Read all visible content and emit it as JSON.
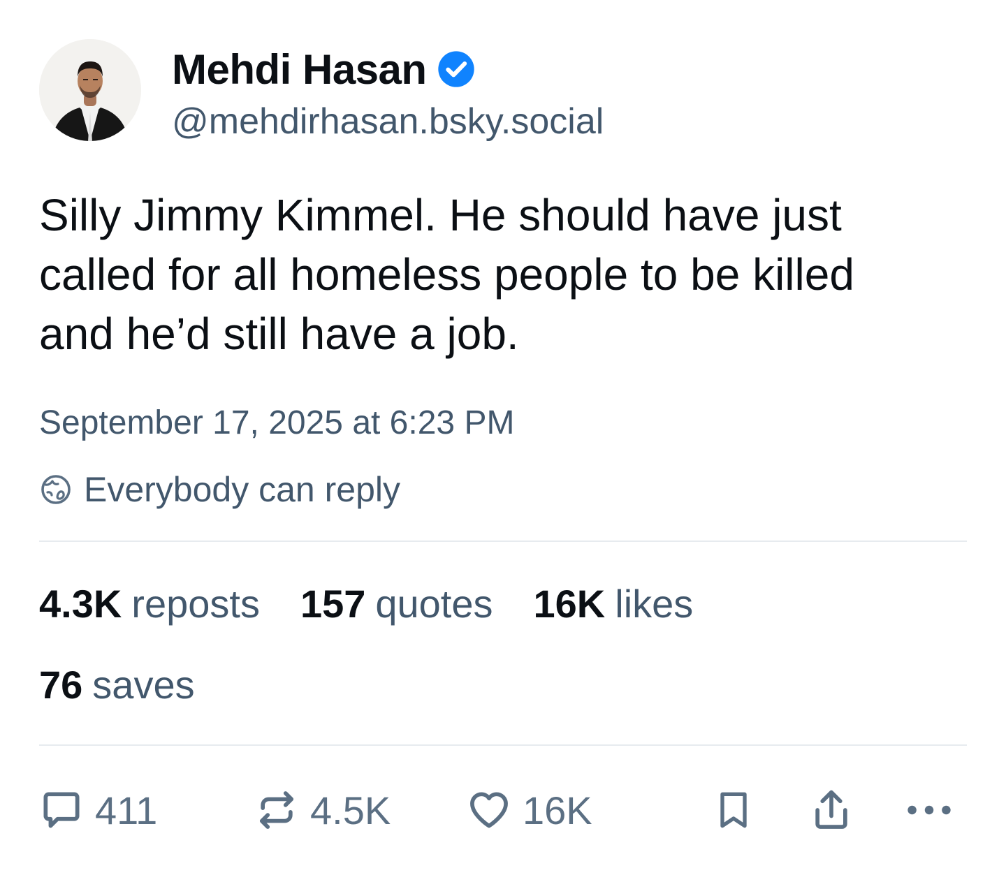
{
  "author": {
    "display_name": "Mehdi Hasan",
    "handle": "@mehdirhasan.bsky.social",
    "verified": true,
    "avatar_icon": "profile-photo"
  },
  "post": {
    "text": "Silly Jimmy Kimmel. He should have just called for all homeless people to be killed and he’d still have a job.",
    "timestamp": "September 17, 2025 at 6:23 PM",
    "reply_setting": "Everybody can reply"
  },
  "stats": {
    "reposts_count": "4.3K",
    "reposts_label": "reposts",
    "quotes_count": "157",
    "quotes_label": "quotes",
    "likes_count": "16K",
    "likes_label": "likes",
    "saves_count": "76",
    "saves_label": "saves"
  },
  "actions": {
    "reply_count": "411",
    "repost_count": "4.5K",
    "like_count": "16K"
  },
  "colors": {
    "text_primary": "#0b0f14",
    "text_secondary": "#42576c",
    "icon": "#5b6f83",
    "verified_badge": "#1083fe",
    "divider": "#e7ebef"
  }
}
